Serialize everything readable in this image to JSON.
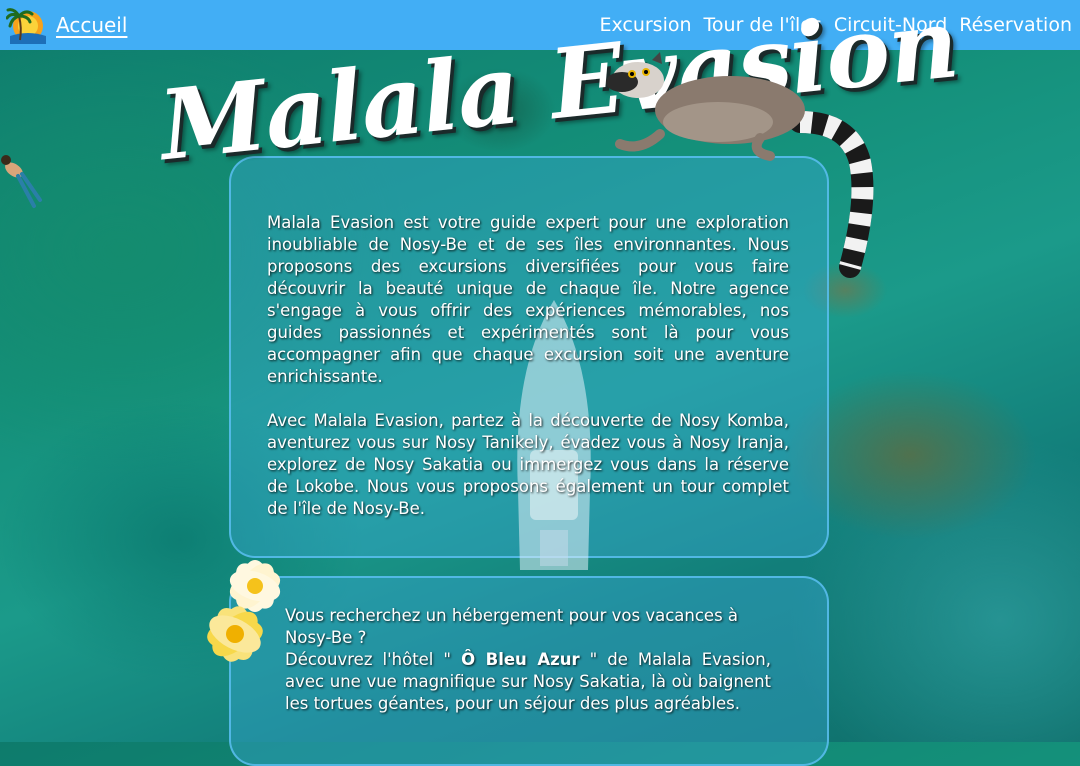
{
  "nav": {
    "home": "Accueil",
    "links": [
      "Excursion",
      "Tour de l'îles",
      "Circuit-Nord",
      "Réservation"
    ]
  },
  "hero": {
    "title": "Malala Evasion"
  },
  "intro": {
    "paragraph1": "Malala Evasion est votre guide expert pour une exploration inoubliable de Nosy-Be et de ses îles environnantes. Nous proposons des excursions diversifiées pour vous faire découvrir la beauté unique de chaque île. Notre agence s'engage à vous offrir des expériences mémorables, nos guides passionnés et expérimentés sont là pour vous accompagner afin que chaque excursion soit une aventure enrichissante.",
    "paragraph2": "Avec Malala Evasion, partez à la découverte de Nosy Komba, aventurez vous sur Nosy Tanikely, évadez vous à Nosy Iranja, explorez de Nosy Sakatia ou immergez vous dans la réserve de Lokobe. Nous vous proposons également un tour complet de l'île de Nosy-Be."
  },
  "hotel": {
    "line1": "Vous recherchez un hébergement pour vos vacances à Nosy-Be ?",
    "line2_prefix": "Découvrez l'hôtel \" ",
    "hotel_name": "Ô Bleu Azur",
    "line2_suffix": " \" de Malala Evasion, avec une vue magnifique sur Nosy Sakatia, là où baignent les tortues géantes, pour un séjour des plus agréables."
  },
  "colors": {
    "navbar": "#42aef5",
    "panel_border": "#5abef0",
    "text": "#ffffff"
  }
}
